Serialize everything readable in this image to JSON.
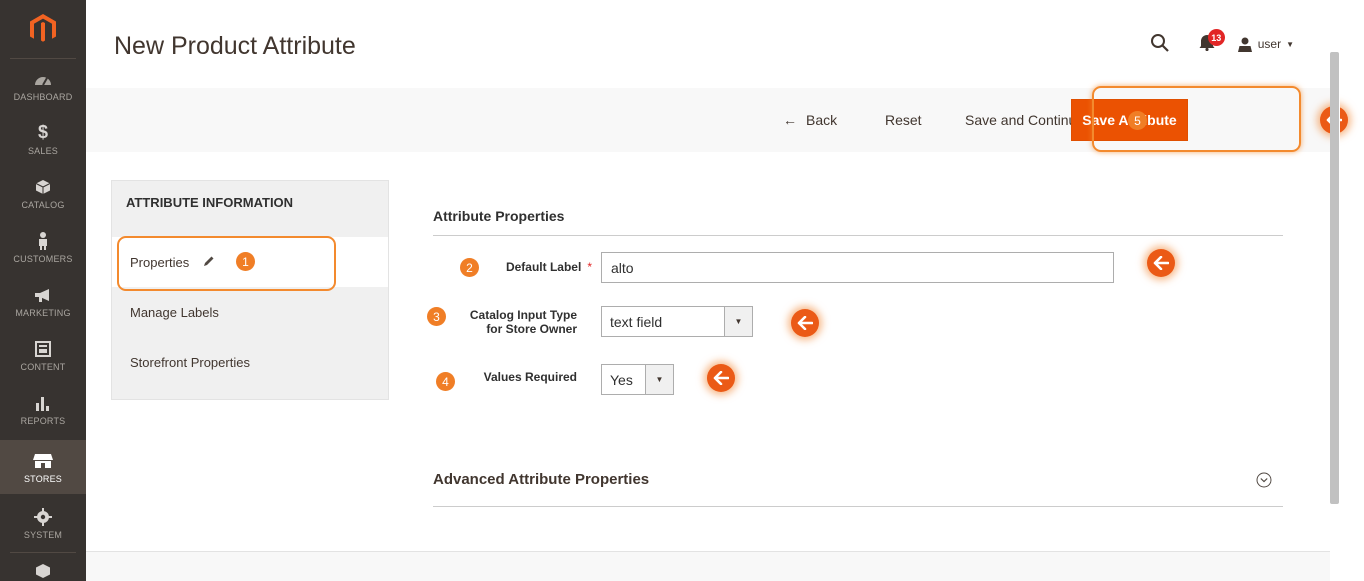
{
  "page": {
    "title": "New Product Attribute"
  },
  "colors": {
    "accent": "#eb5202",
    "highlight": "#f07e26",
    "sidebar": "#373330"
  },
  "sidebar": {
    "items": [
      {
        "label": "DASHBOARD",
        "icon": "dashboard-icon"
      },
      {
        "label": "SALES",
        "icon": "dollar-icon"
      },
      {
        "label": "CATALOG",
        "icon": "cube-icon"
      },
      {
        "label": "CUSTOMERS",
        "icon": "person-icon"
      },
      {
        "label": "MARKETING",
        "icon": "megaphone-icon"
      },
      {
        "label": "CONTENT",
        "icon": "layout-icon"
      },
      {
        "label": "REPORTS",
        "icon": "bar-chart-icon"
      },
      {
        "label": "STORES",
        "icon": "store-icon",
        "active": true
      },
      {
        "label": "SYSTEM",
        "icon": "gear-icon"
      }
    ]
  },
  "header": {
    "notifications_count": "13",
    "user_name": "user"
  },
  "actions": {
    "back_label": "Back",
    "reset_label": "Reset",
    "save_continue_label": "Save and Continue Edit",
    "save_label": "Save Attribute"
  },
  "tabs": {
    "title": "ATTRIBUTE INFORMATION",
    "items": [
      {
        "label": "Properties",
        "active": true
      },
      {
        "label": "Manage Labels"
      },
      {
        "label": "Storefront Properties"
      }
    ]
  },
  "form": {
    "section_title": "Attribute Properties",
    "default_label": {
      "label": "Default Label",
      "required_mark": "*",
      "value": "alto"
    },
    "input_type": {
      "label_line1": "Catalog Input Type",
      "label_line2": "for Store Owner",
      "value": "text field"
    },
    "values_required": {
      "label": "Values Required",
      "value": "Yes"
    },
    "advanced_title": "Advanced Attribute Properties"
  },
  "annotations": {
    "steps": [
      "1",
      "2",
      "3",
      "4",
      "5"
    ]
  }
}
